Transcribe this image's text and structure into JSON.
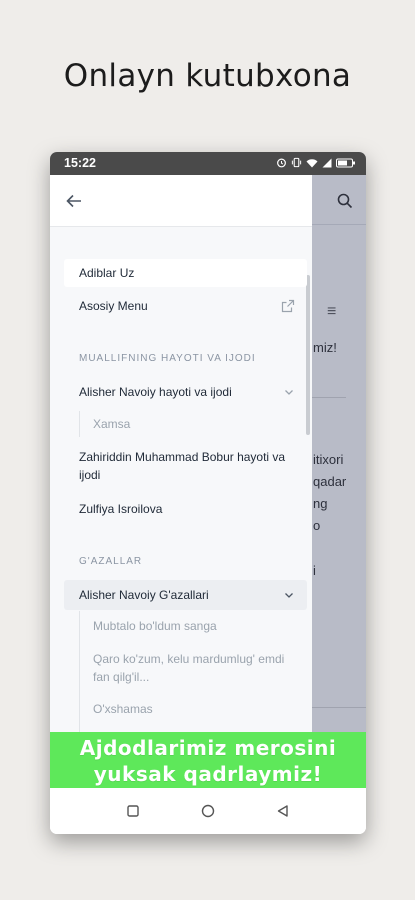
{
  "promo": {
    "title": "Onlayn kutubxona"
  },
  "status_bar": {
    "time": "15:22",
    "icons": [
      "alarm-icon",
      "vibrate-icon",
      "wifi-icon",
      "signal-icon",
      "battery-icon"
    ]
  },
  "background_app": {
    "lines": [
      "miz!",
      "itixori",
      "qadar",
      "ng",
      "o",
      "i"
    ]
  },
  "drawer": {
    "items": [
      {
        "label": "Adiblar Uz",
        "active": true
      },
      {
        "label": "Asosiy Menu",
        "icon": "external-link-icon"
      }
    ],
    "sections": [
      {
        "title": "MUALLIFNING HAYOTI VA IJODI",
        "items": [
          {
            "label": "Alisher Navoiy hayoti va ijodi",
            "expanded": true,
            "children": [
              "Xamsa"
            ]
          },
          {
            "label": "Zahiriddin Muhammad Bobur hayoti va ijodi"
          },
          {
            "label": "Zulfiya Isroilova"
          }
        ]
      },
      {
        "title": "G'AZALLAR",
        "items": [
          {
            "label": "Alisher Navoiy G'azallari",
            "expanded": true,
            "children": [
              "Mubtalo bo'ldum sanga",
              "Qaro ko'zum, kelu mardumlug' emdi fan qilg'il...",
              "O'xshamas"
            ]
          }
        ]
      }
    ]
  },
  "banner": {
    "line1": "Ajdodlarimiz merosini",
    "line2": "yuksak qadrlaymiz!",
    "color": "#5ee85a"
  },
  "system_nav": {
    "buttons": [
      "recent-apps-icon",
      "home-icon",
      "back-icon"
    ]
  }
}
